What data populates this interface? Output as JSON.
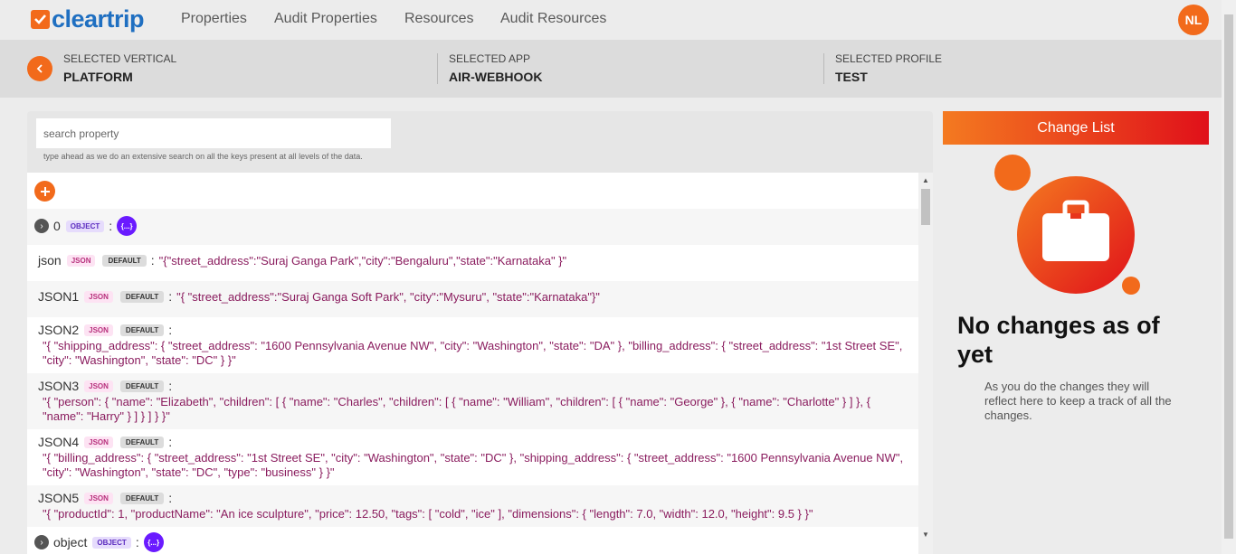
{
  "brand": {
    "name": "cleartrip"
  },
  "nav": {
    "links": [
      "Properties",
      "Audit Properties",
      "Resources",
      "Audit Resources"
    ]
  },
  "user": {
    "initials": "NL"
  },
  "selection": {
    "vertical_label": "SELECTED VERTICAL",
    "vertical_value": "PLATFORM",
    "app_label": "SELECTED APP",
    "app_value": "AIR-WEBHOOK",
    "profile_label": "SELECTED PROFILE",
    "profile_value": "TEST"
  },
  "search": {
    "placeholder": "search property",
    "hint": "type ahead as we do an extensive search on all the keys present at all levels of the data."
  },
  "badges": {
    "json": "JSON",
    "object": "OBJECT",
    "default": "DEFAULT",
    "object_pill": "{...}"
  },
  "properties": [
    {
      "key": "0",
      "type": "OBJECT"
    },
    {
      "key": "json",
      "type": "JSON",
      "value": "\"{\"street_address\":\"Suraj Ganga Park\",\"city\":\"Bengaluru\",\"state\":\"Karnataka\" }\""
    },
    {
      "key": "JSON1",
      "type": "JSON",
      "value": "\"{ \"street_address\":\"Suraj Ganga Soft Park\", \"city\":\"Mysuru\", \"state\":\"Karnataka\"}\""
    },
    {
      "key": "JSON2",
      "type": "JSON",
      "value": "\"{ \"shipping_address\": { \"street_address\": \"1600 Pennsylvania Avenue NW\", \"city\": \"Washington\", \"state\": \"DA\" }, \"billing_address\": { \"street_address\": \"1st Street SE\", \"city\": \"Washington\", \"state\": \"DC\" } }\""
    },
    {
      "key": "JSON3",
      "type": "JSON",
      "value": "\"{ \"person\": { \"name\": \"Elizabeth\", \"children\": [ { \"name\": \"Charles\", \"children\": [ { \"name\": \"William\", \"children\": [ { \"name\": \"George\" }, { \"name\": \"Charlotte\" } ] }, { \"name\": \"Harry\" } ] } ] } }\""
    },
    {
      "key": "JSON4",
      "type": "JSON",
      "value": "\"{ \"billing_address\": { \"street_address\": \"1st Street SE\", \"city\": \"Washington\", \"state\": \"DC\" }, \"shipping_address\": { \"street_address\": \"1600 Pennsylvania Avenue NW\", \"city\": \"Washington\", \"state\": \"DC\", \"type\": \"business\" } }\""
    },
    {
      "key": "JSON5",
      "type": "JSON",
      "value": "\"{ \"productId\": 1, \"productName\": \"An ice sculpture\", \"price\": 12.50, \"tags\": [ \"cold\", \"ice\" ], \"dimensions\": { \"length\": 7.0, \"width\": 12.0, \"height\": 9.5 } }\""
    },
    {
      "key": "object",
      "type": "OBJECT"
    }
  ],
  "change_list": {
    "title": "Change List",
    "empty_title": "No changes as of yet",
    "empty_desc": "As you do the changes they will reflect here to keep a track of all the changes."
  },
  "colors": {
    "accent": "#f26a1b",
    "brand_blue": "#1f6fc1",
    "value": "#8a1c5e",
    "object_pill": "#6a1bff"
  },
  "icons": [
    "check-icon",
    "chevron-left-icon",
    "plus-icon",
    "chevron-right-icon",
    "briefcase-icon"
  ]
}
